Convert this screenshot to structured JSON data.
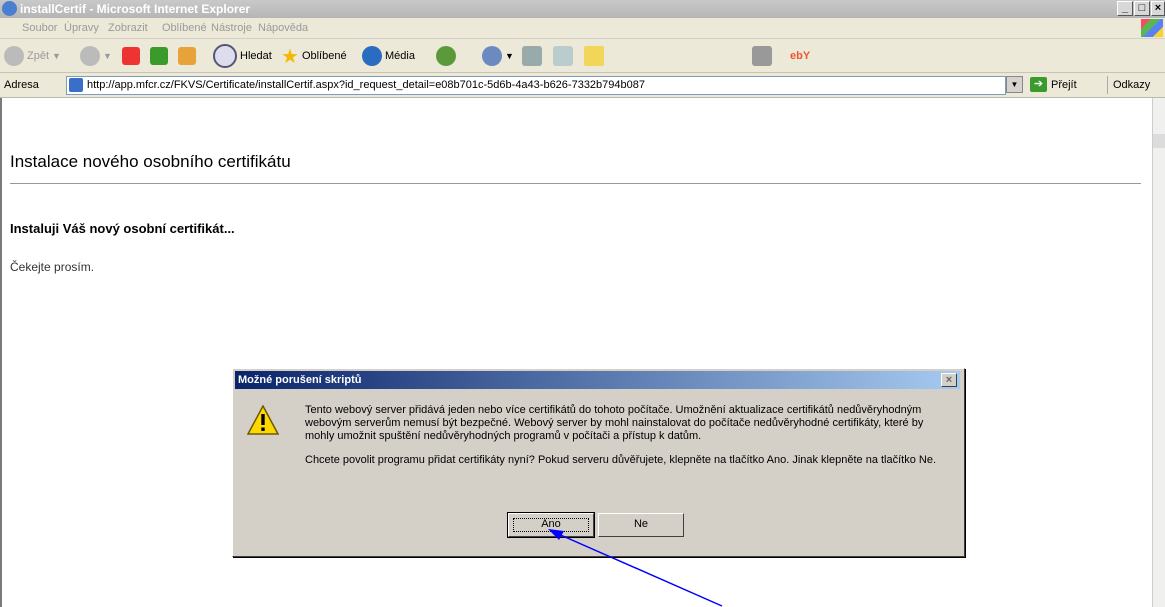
{
  "window": {
    "title": "installCertif - Microsoft Internet Explorer",
    "controls": {
      "minimize": "_",
      "maximize": "□",
      "close": "×"
    }
  },
  "menubar": {
    "items": [
      "Soubor",
      "Úpravy",
      "Zobrazit",
      "Oblíbené",
      "Nástroje",
      "Nápověda"
    ]
  },
  "toolbar": {
    "back_label": "Zpět",
    "search_label": "Hledat",
    "favorites_label": "Oblíbené",
    "media_label": "Média",
    "ebay_label": "ebY"
  },
  "address_bar": {
    "label": "Adresa",
    "url": "http://app.mfcr.cz/FKVS/Certificate/installCertif.aspx?id_request_detail=e08b701c-5d6b-4a43-b626-7332b794b087",
    "go_label": "Přejít",
    "links_label": "Odkazy"
  },
  "page": {
    "heading": "Instalace nového osobního certifikátu",
    "subheading": "Instaluji Váš nový osobní certifikát...",
    "status_text": "Čekejte prosím."
  },
  "dialog": {
    "title": "Možné porušení skriptů",
    "close_glyph": "×",
    "message_1": "Tento webový server přidává jeden nebo více certifikátů do tohoto počítače. Umožnění aktualizace certifikátů nedůvěryhodným webovým serverům nemusí být bezpečné. Webový server by mohl nainstalovat do počítače nedůvěryhodné certifikáty, které by mohly umožnit spuštění nedůvěryhodných programů v počítači a přístup k datům.",
    "message_2": "Chcete povolit programu přidat certifikáty nyní? Pokud serveru důvěřujete, klepněte na tlačítko Ano. Jinak klepněte na tlačítko Ne.",
    "yes_label": "Ano",
    "no_label": "Ne",
    "icon": "warning-icon"
  },
  "annotation": {
    "color": "#0000ff",
    "icon": "arrow-pointer"
  }
}
